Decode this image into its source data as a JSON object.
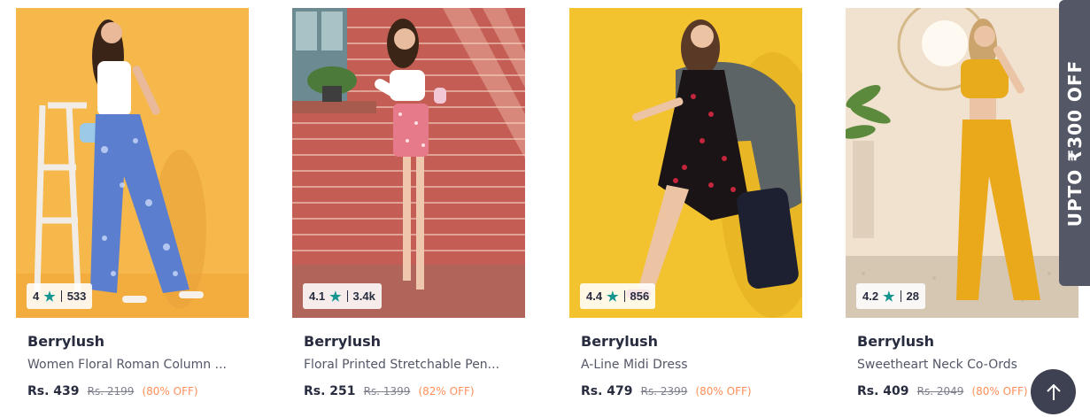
{
  "products": [
    {
      "rating": "4",
      "rating_count": "533",
      "brand": "Berrylush",
      "title": "Women Floral Roman Column ...",
      "price": "Rs. 439",
      "mrp": "Rs. 2199",
      "discount": "(80% OFF)"
    },
    {
      "rating": "4.1",
      "rating_count": "3.4k",
      "brand": "Berrylush",
      "title": "Floral Printed Stretchable Pen...",
      "price": "Rs. 251",
      "mrp": "Rs. 1399",
      "discount": "(82% OFF)"
    },
    {
      "rating": "4.4",
      "rating_count": "856",
      "brand": "Berrylush",
      "title": "A-Line Midi Dress",
      "price": "Rs. 479",
      "mrp": "Rs. 2399",
      "discount": "(80% OFF)"
    },
    {
      "rating": "4.2",
      "rating_count": "28",
      "brand": "Berrylush",
      "title": "Sweetheart Neck Co-Ords",
      "price": "Rs. 409",
      "mrp": "Rs. 2049",
      "discount": "(80% OFF)"
    }
  ],
  "offer_tab": {
    "label": "UPTO ₹300 OFF"
  },
  "icons": {
    "rating": "star-icon",
    "scroll_top": "arrow-up-icon"
  },
  "colors": {
    "star": "#14958f",
    "discount": "#ff905a",
    "offer_tab_bg": "#535766",
    "scroll_button_bg": "#3e4152"
  }
}
